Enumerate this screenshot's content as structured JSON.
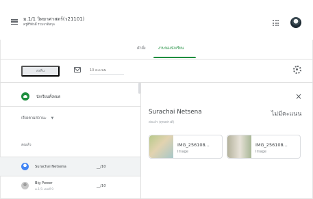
{
  "class": {
    "title": "ม.1/1 วิทยาศาสตร์(ว21101)",
    "subtitle": "ครูศิริศักดิ์ ร่วมจาติสกุล"
  },
  "tabs": [
    {
      "label": "คำสั่ง",
      "active": false
    },
    {
      "label": "งานของนักเรียน",
      "active": true
    }
  ],
  "toolbar": {
    "return_label": "ส่งคืน",
    "points_placeholder": "10 คะแนน"
  },
  "left_pane": {
    "all_students_label": "นักเรียนทั้งหมด",
    "sort_label": "เรียงตามสถานะ",
    "section_label": "ส่งแล้ว",
    "students": [
      {
        "name": "Surachai Netsena",
        "meta": "",
        "score": "__/10"
      },
      {
        "name": "Big Power",
        "meta": "ม.1/1 เลขที่ 9",
        "score": "__/10"
      }
    ]
  },
  "right_pane": {
    "selected_name": "Surachai Netsena",
    "selected_status": "ส่งแล้ว (ทุกอย่างดี)",
    "grade_status": "ไม่มีคะแนน",
    "attachments": [
      {
        "name": "IMG_256108...",
        "type": "Image"
      },
      {
        "name": "IMG_256108...",
        "type": "Image"
      }
    ]
  },
  "colors": {
    "accent": "#1e8e3e",
    "text": "#3c4043",
    "muted": "#5f6368",
    "border": "#dadce0",
    "selected_row": "#f1f3f4"
  }
}
